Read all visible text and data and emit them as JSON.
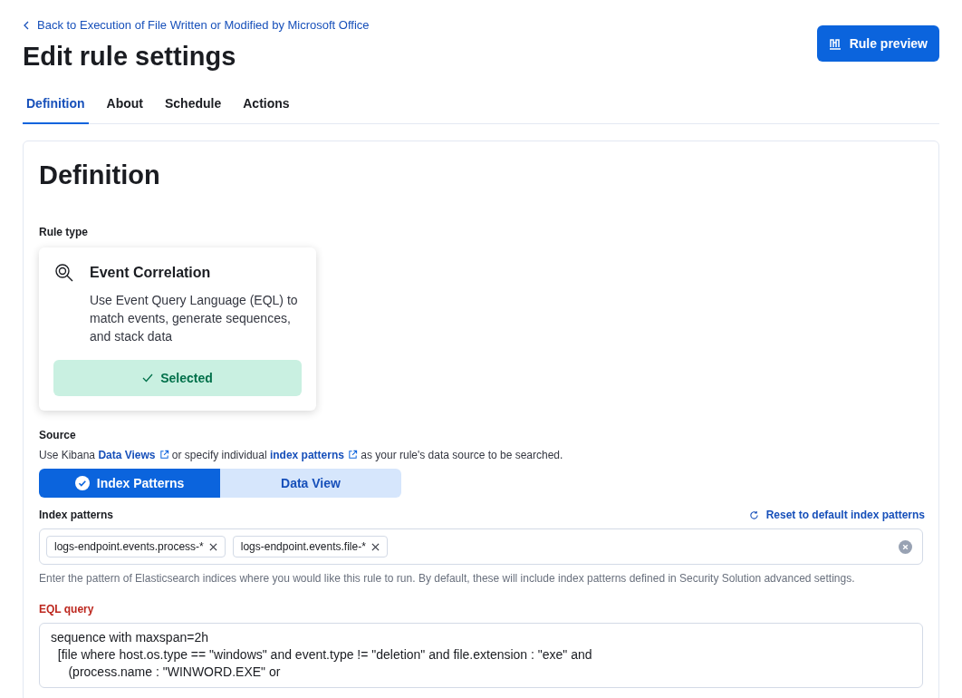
{
  "back_link": "Back to Execution of File Written or Modified by Microsoft Office",
  "title": "Edit rule settings",
  "preview_button": "Rule preview",
  "tabs": [
    {
      "label": "Definition",
      "selected": true
    },
    {
      "label": "About",
      "selected": false
    },
    {
      "label": "Schedule",
      "selected": false
    },
    {
      "label": "Actions",
      "selected": false
    }
  ],
  "panel": {
    "heading": "Definition",
    "rule_type": {
      "label": "Rule type",
      "title": "Event Correlation",
      "description": "Use Event Query Language (EQL) to match events, generate sequences, and stack data",
      "selected": true,
      "selected_label": "Selected"
    },
    "source": {
      "label": "Source",
      "description": [
        {
          "kind": "text",
          "text": "Use Kibana "
        },
        {
          "kind": "link",
          "text": "Data Views"
        },
        {
          "kind": "text",
          "text": " or specify individual "
        },
        {
          "kind": "link",
          "text": "index patterns"
        },
        {
          "kind": "text",
          "text": " as your rule's data source to be searched."
        }
      ],
      "options": [
        {
          "label": "Index Patterns",
          "selected": true
        },
        {
          "label": "Data View",
          "selected": false
        }
      ]
    },
    "index_patterns": {
      "label": "Index patterns",
      "reset_link": "Reset to default index patterns",
      "values": [
        "logs-endpoint.events.process-*",
        "logs-endpoint.events.file-*"
      ],
      "help": "Enter the pattern of Elasticsearch indices where you would like this rule to run. By default, these will include index patterns defined in Security Solution advanced settings."
    },
    "eql_query": {
      "label": "EQL query",
      "lines": [
        "sequence with maxspan=2h",
        "  [file where host.os.type == \"windows\" and event.type != \"deletion\" and file.extension : \"exe\" and",
        "     (process.name : \"WINWORD.EXE\" or"
      ]
    }
  }
}
